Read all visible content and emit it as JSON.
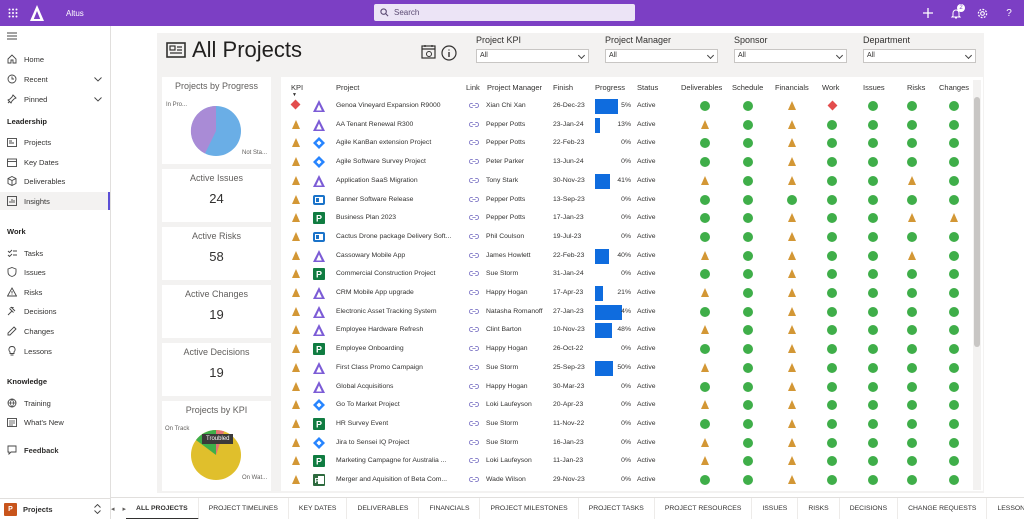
{
  "app": {
    "name": "Altus"
  },
  "search": {
    "placeholder": "Search"
  },
  "notifications_count": "2",
  "nav": {
    "top": [
      {
        "label": "Home",
        "icon": "home-icon"
      },
      {
        "label": "Recent",
        "icon": "clock-icon"
      },
      {
        "label": "Pinned",
        "icon": "pin-icon"
      }
    ],
    "sections": [
      {
        "title": "Leadership",
        "items": [
          "Projects",
          "Key Dates",
          "Deliverables",
          "Insights"
        ]
      },
      {
        "title": "Work",
        "items": [
          "Tasks",
          "Issues",
          "Risks",
          "Decisions",
          "Changes",
          "Lessons"
        ]
      },
      {
        "title": "Knowledge",
        "items": [
          "Training",
          "What's New"
        ]
      }
    ],
    "feedback": "Feedback",
    "area": {
      "initial": "P",
      "label": "Projects"
    }
  },
  "page": {
    "title": "All Projects"
  },
  "filters": [
    {
      "label": "Project KPI",
      "value": "All"
    },
    {
      "label": "Project Manager",
      "value": "All"
    },
    {
      "label": "Sponsor",
      "value": "All"
    },
    {
      "label": "Department",
      "value": "All"
    }
  ],
  "cards": {
    "progress": {
      "title": "Projects by Progress",
      "label_a": "In Pro...",
      "label_b": "Not Sta..."
    },
    "issues": {
      "title": "Active Issues",
      "value": "24"
    },
    "risks": {
      "title": "Active Risks",
      "value": "58"
    },
    "changes": {
      "title": "Active Changes",
      "value": "19"
    },
    "decisions": {
      "title": "Active Decisions",
      "value": "19"
    },
    "kpi": {
      "title": "Projects by KPI",
      "label_a": "On Track",
      "label_b": "On Wat...",
      "tooltip": "Troubled"
    }
  },
  "colors": {
    "accent": "#7c3fc4",
    "green": "#3fae49",
    "amber": "#d39735",
    "red": "#e34d4d",
    "bar": "#0f6cde"
  },
  "table": {
    "columns": [
      "KPI",
      "Project",
      "Link",
      "Project Manager",
      "Finish",
      "Progress",
      "Status",
      "Deliverables",
      "Schedule",
      "Financials",
      "Work",
      "Issues",
      "Risks",
      "Changes"
    ],
    "rows": [
      {
        "kpi": "red",
        "icon": "altus",
        "name": "Genoa Vineyard Expansion R9000",
        "pm": "Xian Chi Xan",
        "finish": "26-Dec-23",
        "progress": 65,
        "progress_text": "5%",
        "status": "Active",
        "d": "g",
        "s": "g",
        "f": "a",
        "w": "r",
        "i": "g",
        "r": "g",
        "c": "g"
      },
      {
        "kpi": "amber",
        "icon": "altus",
        "name": "AA Tenant Renewal R300",
        "pm": "Pepper Potts",
        "finish": "23-Jan-24",
        "progress": 13,
        "progress_text": "13%",
        "status": "Active",
        "d": "a",
        "s": "g",
        "f": "a",
        "w": "g",
        "i": "g",
        "r": "g",
        "c": "g"
      },
      {
        "kpi": "amber",
        "icon": "jira",
        "name": "Agile KanBan extension Project",
        "pm": "Pepper Potts",
        "finish": "22-Feb-23",
        "progress": 0,
        "progress_text": "0%",
        "status": "Active",
        "d": "g",
        "s": "g",
        "f": "a",
        "w": "g",
        "i": "g",
        "r": "g",
        "c": "g"
      },
      {
        "kpi": "amber",
        "icon": "jira",
        "name": "Agile Software Survey Project",
        "pm": "Peter Parker",
        "finish": "13-Jun-24",
        "progress": 0,
        "progress_text": "0%",
        "status": "Active",
        "d": "g",
        "s": "g",
        "f": "a",
        "w": "g",
        "i": "g",
        "r": "g",
        "c": "g"
      },
      {
        "kpi": "amber",
        "icon": "altus",
        "name": "Application SaaS Migration",
        "pm": "Tony Stark",
        "finish": "30-Nov-23",
        "progress": 41,
        "progress_text": "41%",
        "status": "Active",
        "d": "a",
        "s": "g",
        "f": "a",
        "w": "g",
        "i": "g",
        "r": "a",
        "c": "g"
      },
      {
        "kpi": "amber",
        "icon": "planner",
        "name": "Banner Software Release",
        "pm": "Pepper Potts",
        "finish": "13-Sep-23",
        "progress": 0,
        "progress_text": "0%",
        "status": "Active",
        "d": "g",
        "s": "g",
        "f": "g",
        "w": "g",
        "i": "g",
        "r": "g",
        "c": "g"
      },
      {
        "kpi": "amber",
        "icon": "project",
        "name": "Business Plan 2023",
        "pm": "Pepper Potts",
        "finish": "17-Jan-23",
        "progress": 0,
        "progress_text": "0%",
        "status": "Active",
        "d": "g",
        "s": "g",
        "f": "a",
        "w": "g",
        "i": "g",
        "r": "a",
        "c": "a"
      },
      {
        "kpi": "amber",
        "icon": "planner",
        "name": "Cactus Drone package Delivery Soft...",
        "pm": "Phil Coulson",
        "finish": "19-Jul-23",
        "progress": 0,
        "progress_text": "0%",
        "status": "Active",
        "d": "g",
        "s": "g",
        "f": "a",
        "w": "g",
        "i": "g",
        "r": "g",
        "c": "g"
      },
      {
        "kpi": "amber",
        "icon": "altus",
        "name": "Cassowary Mobile App",
        "pm": "James Howlett",
        "finish": "22-Feb-23",
        "progress": 40,
        "progress_text": "40%",
        "status": "Active",
        "d": "a",
        "s": "g",
        "f": "a",
        "w": "g",
        "i": "g",
        "r": "a",
        "c": "g"
      },
      {
        "kpi": "amber",
        "icon": "project",
        "name": "Commercial Construction Project",
        "pm": "Sue Storm",
        "finish": "31-Jan-24",
        "progress": 0,
        "progress_text": "0%",
        "status": "Active",
        "d": "g",
        "s": "g",
        "f": "a",
        "w": "g",
        "i": "g",
        "r": "g",
        "c": "g"
      },
      {
        "kpi": "amber",
        "icon": "altus",
        "name": "CRM Mobile App upgrade",
        "pm": "Happy Hogan",
        "finish": "17-Apr-23",
        "progress": 21,
        "progress_text": "21%",
        "status": "Active",
        "d": "a",
        "s": "g",
        "f": "a",
        "w": "g",
        "i": "g",
        "r": "g",
        "c": "g"
      },
      {
        "kpi": "amber",
        "icon": "altus",
        "name": "Electronic Asset Tracking System",
        "pm": "Natasha Romanoff",
        "finish": "27-Jan-23",
        "progress": 74,
        "progress_text": "4%",
        "status": "Active",
        "d": "g",
        "s": "g",
        "f": "a",
        "w": "g",
        "i": "g",
        "r": "g",
        "c": "g"
      },
      {
        "kpi": "amber",
        "icon": "altus",
        "name": "Employee Hardware Refresh",
        "pm": "Clint Barton",
        "finish": "10-Nov-23",
        "progress": 48,
        "progress_text": "48%",
        "status": "Active",
        "d": "a",
        "s": "g",
        "f": "a",
        "w": "g",
        "i": "g",
        "r": "g",
        "c": "g"
      },
      {
        "kpi": "amber",
        "icon": "project",
        "name": "Employee Onboarding",
        "pm": "Happy Hogan",
        "finish": "26-Oct-22",
        "progress": 0,
        "progress_text": "0%",
        "status": "Active",
        "d": "g",
        "s": "g",
        "f": "a",
        "w": "g",
        "i": "g",
        "r": "g",
        "c": "g"
      },
      {
        "kpi": "amber",
        "icon": "altus",
        "name": "First Class Promo Campaign",
        "pm": "Sue Storm",
        "finish": "25-Sep-23",
        "progress": 50,
        "progress_text": "50%",
        "status": "Active",
        "d": "a",
        "s": "g",
        "f": "a",
        "w": "g",
        "i": "g",
        "r": "g",
        "c": "g"
      },
      {
        "kpi": "amber",
        "icon": "altus",
        "name": "Global Acquisitions",
        "pm": "Happy Hogan",
        "finish": "30-Mar-23",
        "progress": 0,
        "progress_text": "0%",
        "status": "Active",
        "d": "g",
        "s": "g",
        "f": "a",
        "w": "g",
        "i": "g",
        "r": "g",
        "c": "g"
      },
      {
        "kpi": "amber",
        "icon": "jira",
        "name": "Go To Market Project",
        "pm": "Loki Laufeyson",
        "finish": "20-Apr-23",
        "progress": 0,
        "progress_text": "0%",
        "status": "Active",
        "d": "a",
        "s": "g",
        "f": "a",
        "w": "g",
        "i": "g",
        "r": "g",
        "c": "g"
      },
      {
        "kpi": "amber",
        "icon": "project",
        "name": "HR Survey Event",
        "pm": "Sue Storm",
        "finish": "11-Nov-22",
        "progress": 0,
        "progress_text": "0%",
        "status": "Active",
        "d": "g",
        "s": "g",
        "f": "a",
        "w": "g",
        "i": "g",
        "r": "g",
        "c": "g"
      },
      {
        "kpi": "amber",
        "icon": "jira",
        "name": "Jira to Sensei IQ Project",
        "pm": "Sue Storm",
        "finish": "16-Jan-23",
        "progress": 0,
        "progress_text": "0%",
        "status": "Active",
        "d": "a",
        "s": "g",
        "f": "a",
        "w": "g",
        "i": "g",
        "r": "g",
        "c": "g"
      },
      {
        "kpi": "amber",
        "icon": "project",
        "name": "Marketing Campagne for Australia ...",
        "pm": "Loki Laufeyson",
        "finish": "11-Jan-23",
        "progress": 0,
        "progress_text": "0%",
        "status": "Active",
        "d": "a",
        "s": "g",
        "f": "a",
        "w": "g",
        "i": "g",
        "r": "g",
        "c": "g"
      },
      {
        "kpi": "amber",
        "icon": "project2",
        "name": "Merger and Aquisition of Beta Com...",
        "pm": "Wade Wilson",
        "finish": "29-Nov-23",
        "progress": 0,
        "progress_text": "0%",
        "status": "Active",
        "d": "g",
        "s": "g",
        "f": "a",
        "w": "g",
        "i": "g",
        "r": "g",
        "c": "g"
      }
    ]
  },
  "tabs": [
    "ALL PROJECTS",
    "PROJECT TIMELINES",
    "KEY DATES",
    "DELIVERABLES",
    "FINANCIALS",
    "PROJECT MILESTONES",
    "PROJECT TASKS",
    "PROJECT RESOURCES",
    "ISSUES",
    "RISKS",
    "DECISIONS",
    "CHANGE REQUESTS",
    "LESSONS LEARNED"
  ]
}
